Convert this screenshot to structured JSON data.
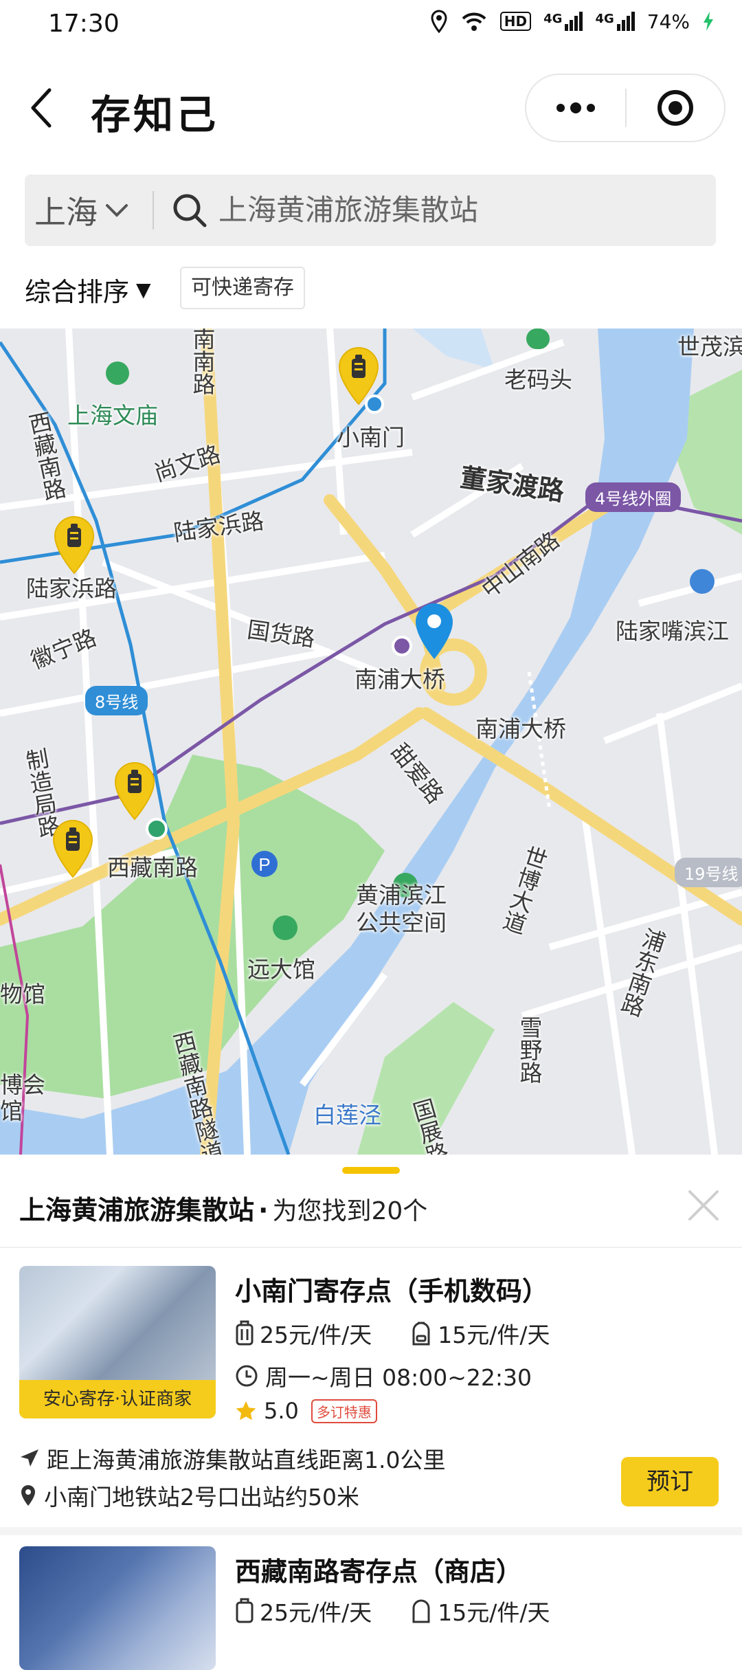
{
  "status_bar": {
    "time": "17:30",
    "network1": "4G",
    "network2": "4G",
    "hd": "HD",
    "battery": "74%"
  },
  "header": {
    "title": "存知己"
  },
  "search": {
    "city": "上海",
    "query": "上海黄浦旅游集散站"
  },
  "filters": {
    "sort_label": "综合排序",
    "sort_arrow": "▼",
    "express_tag": "可快递寄存"
  },
  "map": {
    "labels": {
      "nannan_rd": "南南路",
      "shanghai_wenmiao": "上海文庙",
      "xizang_s_rd": "西藏南路",
      "shangwen_rd": "尚文路",
      "xiaonanmen": "小南门",
      "laomatou": "老码头",
      "shimao": "世茂滨",
      "dongjiadu_rd": "董家渡路",
      "lujiabang_rd": "陆家浜路",
      "lujiabang_station": "陆家浜路",
      "zhongshan_s_rd": "中山南路",
      "guohuo_rd": "国货路",
      "huining_rd": "徽宁路",
      "nanpu_bridge_station": "南浦大桥",
      "nanpu_bridge": "南浦大桥",
      "lujiazui_binjiang": "陆家嘴滨江",
      "zhizaoju_rd": "制造局路",
      "tianli_rd": "甜爱路",
      "xizang_s_rd_station": "西藏南路",
      "huangpu_binjiang": "黄浦滨江",
      "public_space": "公共空间",
      "shibo_rd": "世博大道",
      "pudong_s_rd": "浦东南路",
      "museum": "物馆",
      "yuandaguan": "远大馆",
      "bohui": "博会",
      "guan": "馆",
      "xizang_s_rd_tunnel": "西藏南路隧道",
      "bailianjing": "白莲泾",
      "guozhan_rd": "国展路",
      "xueye_rd": "雪野路"
    },
    "badges": {
      "line4": "4号线外圈",
      "line8": "8号线",
      "line19": "19号线"
    },
    "colors": {
      "water": "#a9cdf2",
      "park": "#a8e0a0",
      "road_major": "#f7dc8a",
      "line4": "#7b57a6",
      "line8": "#2f8ed6",
      "pin": "#1d8fe0",
      "locker_pin": "#f3c716"
    }
  },
  "results": {
    "title": "上海黄浦旅游集散站",
    "dot": "·",
    "count_text": "为您找到20个",
    "cards": [
      {
        "name": "小南门寄存点（手机数码）",
        "badge": "安心寄存·认证商家",
        "price_luggage": "25元/件/天",
        "price_bag": "15元/件/天",
        "hours": "周一~周日 08:00~22:30",
        "rating": "5.0",
        "promo": "多订特惠",
        "distance": "距上海黄浦旅游集散站直线距离1.0公里",
        "location": "小南门地铁站2号口出站约50米",
        "book_label": "预订"
      },
      {
        "name": "西藏南路寄存点（商店）",
        "price_luggage": "25元/件/天",
        "price_bag": "15元/件/天"
      }
    ]
  }
}
